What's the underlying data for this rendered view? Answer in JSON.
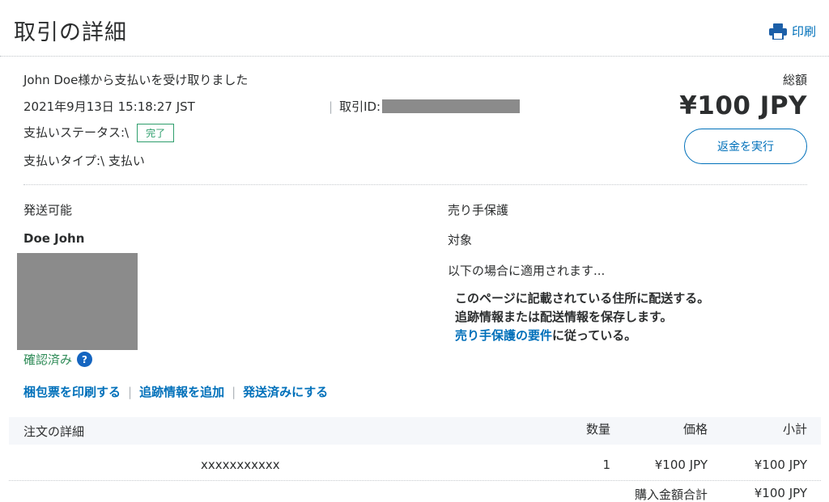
{
  "header": {
    "title": "取引の詳細",
    "print_label": "印刷",
    "print_icon": "printer-icon"
  },
  "summary": {
    "received_from": "John Doe様から支払いを受け取りました",
    "datetime": "2021年9月13日 15:18:27 JST",
    "status_label": "支払いステータス:\\",
    "status_badge": "完了",
    "type_label": "支払いタイプ:\\ 支払い",
    "txn_id_sep": "|",
    "txn_id_label": "取引ID:",
    "total_label": "総額",
    "total_amount": "¥100 JPY",
    "refund_button": "返金を実行"
  },
  "shipping": {
    "heading": "発送可能",
    "name": "Doe John",
    "verified_label": "確認済み",
    "help_icon": "?"
  },
  "actions": {
    "print_slip": "梱包票を印刷する",
    "sep1": "|",
    "add_tracking": "追跡情報を追加",
    "sep2": "|",
    "mark_shipped": "発送済みにする"
  },
  "seller_protection": {
    "heading": "売り手保護",
    "target": "対象",
    "applies_when": "以下の場合に適用されます...",
    "cond1": "このページに記載されている住所に配送する。",
    "cond2": "追跡情報または配送情報を保存します。",
    "cond3_link": "売り手保護の要件",
    "cond3_rest": "に従っている。"
  },
  "order": {
    "header_title": "注文の詳細",
    "col_qty": "数量",
    "col_price": "価格",
    "col_subtotal": "小計",
    "item": {
      "name": "xxxxxxxxxxx",
      "qty": "1",
      "price": "¥100 JPY",
      "subtotal": "¥100 JPY"
    },
    "purchase_total_label": "購入金額合計",
    "purchase_total_value": "¥100 JPY"
  },
  "colors": {
    "accent": "#0070ba",
    "status_green": "#2e9e6c",
    "redacted_gray": "#8b8b8b"
  }
}
